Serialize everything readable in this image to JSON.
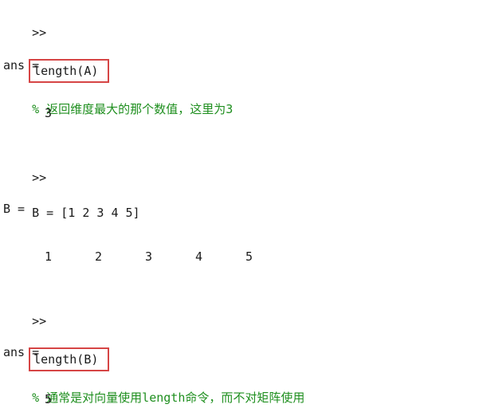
{
  "console": {
    "prompt": ">>",
    "line1": {
      "command": "length(A)",
      "comment": "% 返回维度最大的那个数值，这里为3"
    },
    "ans1_label": "ans =",
    "ans1_value": "3",
    "line2": {
      "command": "B = [1 2 3 4 5]"
    },
    "b_label": "B =",
    "b_values": [
      "1",
      "2",
      "3",
      "4",
      "5"
    ],
    "line3": {
      "command": "length(B)",
      "comment": "% 通常是对向量使用length命令，而不对矩阵使用"
    },
    "ans2_label": "ans =",
    "ans2_value": "5"
  },
  "colors": {
    "comment": "#1f8f1f",
    "highlight_box": "#d64545",
    "text": "#1a1a1a",
    "background": "#ffffff"
  }
}
